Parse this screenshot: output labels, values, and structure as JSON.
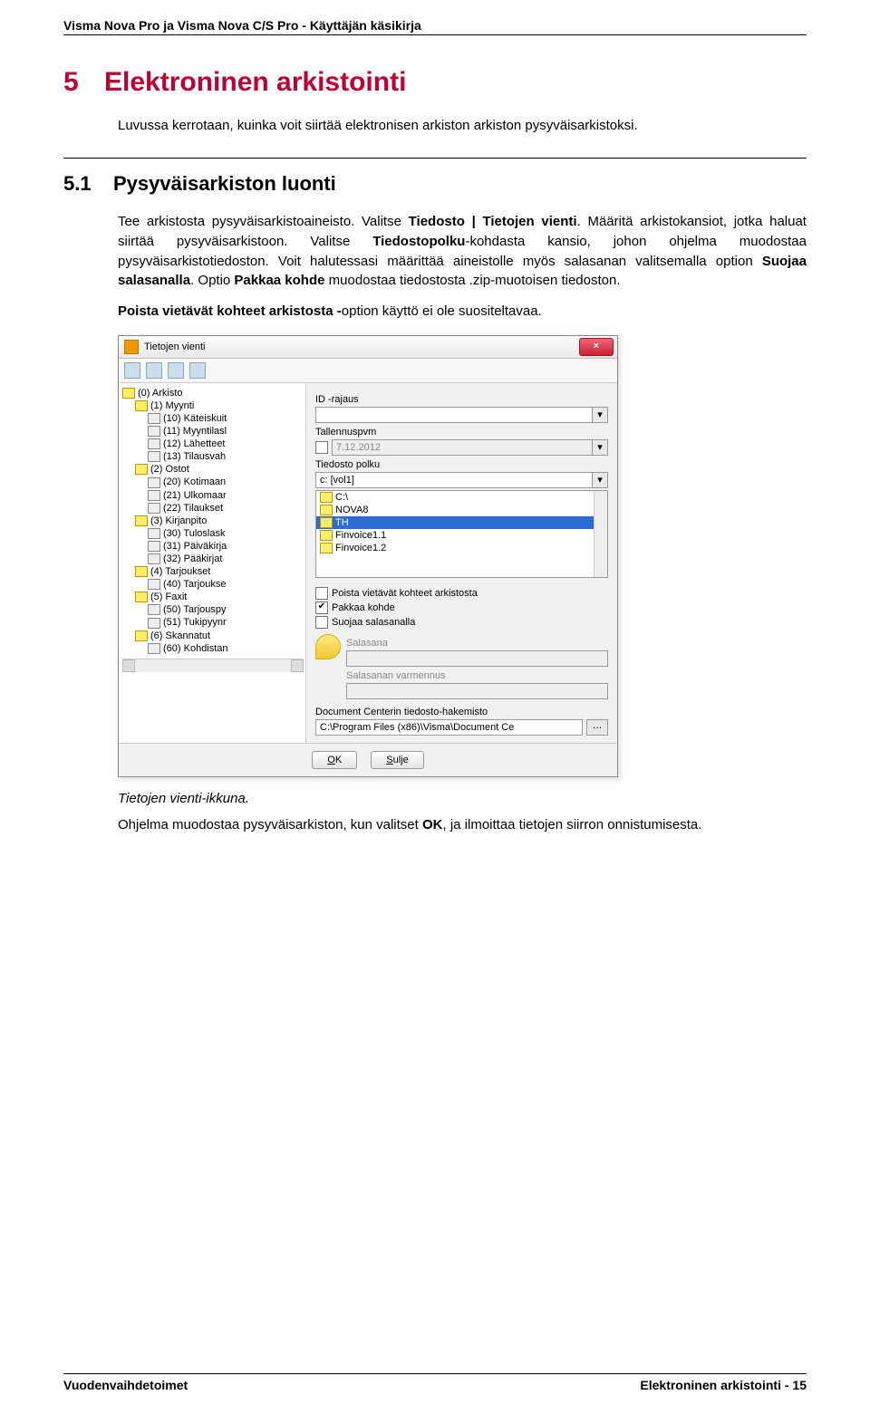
{
  "header": "Visma Nova Pro ja Visma Nova C/S Pro - Käyttäjän käsikirja",
  "h1_num": "5",
  "h1_text": "Elektroninen arkistointi",
  "intro": "Luvussa kerrotaan, kuinka voit siirtää elektronisen arkiston arkiston pysyväisarkistoksi.",
  "h2_num": "5.1",
  "h2_text": "Pysyväisarkiston luonti",
  "para1_a": "Tee arkistosta pysyväisarkistoaineisto. Valitse ",
  "para1_b": "Tiedosto | Tietojen vienti",
  "para1_c": ". Määritä arkistokansiot, jotka haluat siirtää pysyväisarkistoon. Valitse ",
  "para1_d": "Tiedostopolku",
  "para1_e": "-kohdasta kansio, johon ohjelma muodostaa pysyväisarkistotiedoston. Voit halutessasi määrittää aineistolle myös salasanan valitsemalla option ",
  "para1_f": "Suojaa salasanalla",
  "para1_g": ". Optio ",
  "para1_h": "Pakkaa kohde",
  "para1_i": " muodostaa tiedostosta .zip-muotoisen tiedoston.",
  "para2_a": "Poista vietävät kohteet arkistosta -",
  "para2_b": "option käyttö ei ole suositeltavaa.",
  "shot": {
    "title": "Tietojen vienti",
    "close": "×",
    "tree": [
      {
        "lvl": 0,
        "ico": "f",
        "txt": "(0) Arkisto"
      },
      {
        "lvl": 1,
        "ico": "f",
        "txt": "(1) Myynti"
      },
      {
        "lvl": 2,
        "ico": "d",
        "txt": "(10) Käteiskuit"
      },
      {
        "lvl": 2,
        "ico": "d",
        "txt": "(11) Myyntilasl"
      },
      {
        "lvl": 2,
        "ico": "d",
        "txt": "(12) Lähetteet"
      },
      {
        "lvl": 2,
        "ico": "d",
        "txt": "(13) Tilausvah"
      },
      {
        "lvl": 1,
        "ico": "f",
        "txt": "(2) Ostot"
      },
      {
        "lvl": 2,
        "ico": "d",
        "txt": "(20) Kotimaan"
      },
      {
        "lvl": 2,
        "ico": "d",
        "txt": "(21) Ulkomaar"
      },
      {
        "lvl": 2,
        "ico": "d",
        "txt": "(22) Tilaukset"
      },
      {
        "lvl": 1,
        "ico": "f",
        "txt": "(3) Kirjanpito"
      },
      {
        "lvl": 2,
        "ico": "d",
        "txt": "(30) Tuloslask"
      },
      {
        "lvl": 2,
        "ico": "d",
        "txt": "(31) Päiväkirja"
      },
      {
        "lvl": 2,
        "ico": "d",
        "txt": "(32) Pääkirjat"
      },
      {
        "lvl": 1,
        "ico": "f",
        "txt": "(4) Tarjoukset"
      },
      {
        "lvl": 2,
        "ico": "d",
        "txt": "(40) Tarjoukse"
      },
      {
        "lvl": 1,
        "ico": "f",
        "txt": "(5) Faxit"
      },
      {
        "lvl": 2,
        "ico": "d",
        "txt": "(50) Tarjouspy"
      },
      {
        "lvl": 2,
        "ico": "d",
        "txt": "(51) Tukipyynr"
      },
      {
        "lvl": 1,
        "ico": "f",
        "txt": "(6) Skannatut"
      },
      {
        "lvl": 2,
        "ico": "d",
        "txt": "(60) Kohdistan"
      }
    ],
    "id_label": "ID -rajaus",
    "tallennus_label": "Tallennuspvm",
    "tallennus_value": "7.12.2012",
    "path_label": "Tiedosto polku",
    "drive": "c: [vol1]",
    "list": [
      {
        "txt": "C:\\",
        "sel": false
      },
      {
        "txt": "NOVA8",
        "sel": false
      },
      {
        "txt": "TH",
        "sel": true
      },
      {
        "txt": "Finvoice1.1",
        "sel": false
      },
      {
        "txt": "Finvoice1.2",
        "sel": false
      }
    ],
    "chk1": "Poista vietävät kohteet arkistosta",
    "chk2": "Pakkaa kohde",
    "chk3": "Suojaa salasanalla",
    "pw_label": "Salasana",
    "pw2_label": "Salasanan varmennus",
    "dc_label": "Document Centerin tiedosto-hakemisto",
    "dc_value": "C:\\Program Files (x86)\\Visma\\Document Ce",
    "ok": "OK",
    "sulje": "Sulje"
  },
  "caption": "Tietojen vienti-ikkuna.",
  "para3_a": "Ohjelma muodostaa pysyväisarkiston, kun valitset ",
  "para3_b": "OK",
  "para3_c": ", ja ilmoittaa tietojen siirron onnistumisesta.",
  "footer_left": "Vuodenvaihdetoimet",
  "footer_right": "Elektroninen arkistointi - 15"
}
